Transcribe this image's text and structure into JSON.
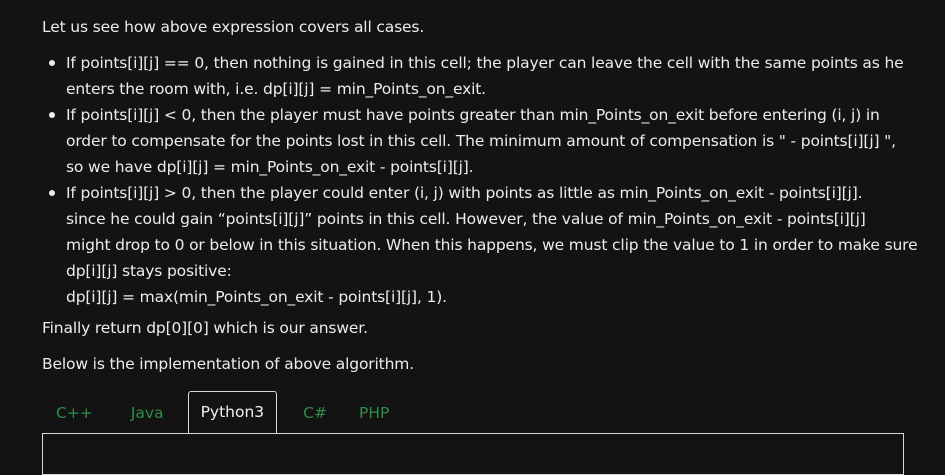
{
  "article": {
    "intro": "Let us see how above expression covers all cases.",
    "cases": [
      {
        "lines": [
          "If points[i][j] == 0, then nothing is gained in this cell; the player can leave the cell with the same points as he",
          "enters the room with, i.e. dp[i][j] = min_Points_on_exit."
        ]
      },
      {
        "lines": [
          "If points[i][j] < 0, then the player must have points greater than min_Points_on_exit before entering (i, j) in",
          "order to compensate for the points lost in this cell. The minimum amount of compensation is \" - points[i][j] \",",
          "so we have dp[i][j] = min_Points_on_exit - points[i][j]."
        ]
      },
      {
        "lines": [
          "If points[i][j] > 0, then the player could enter (i, j) with points as little as min_Points_on_exit - points[i][j].",
          "since he could gain “points[i][j]” points in this cell. However, the value of min_Points_on_exit - points[i][j]",
          "might drop to 0 or below in this situation. When this happens, we must clip the value to 1 in order to make sure",
          "dp[i][j] stays positive:",
          "dp[i][j] = max(min_Points_on_exit - points[i][j], 1)."
        ]
      }
    ],
    "finally": "Finally return dp[0][0] which is our answer.",
    "below": "Below is the implementation of above algorithm."
  },
  "tabs": [
    {
      "label": "C++",
      "active": false
    },
    {
      "label": "Java",
      "active": false
    },
    {
      "label": "Python3",
      "active": true
    },
    {
      "label": "C#",
      "active": false
    },
    {
      "label": "PHP",
      "active": false
    }
  ],
  "colors": {
    "background": "#131313",
    "text": "#ececec",
    "tab_link": "#2f8d46",
    "tab_border": "#d9d9d9"
  }
}
